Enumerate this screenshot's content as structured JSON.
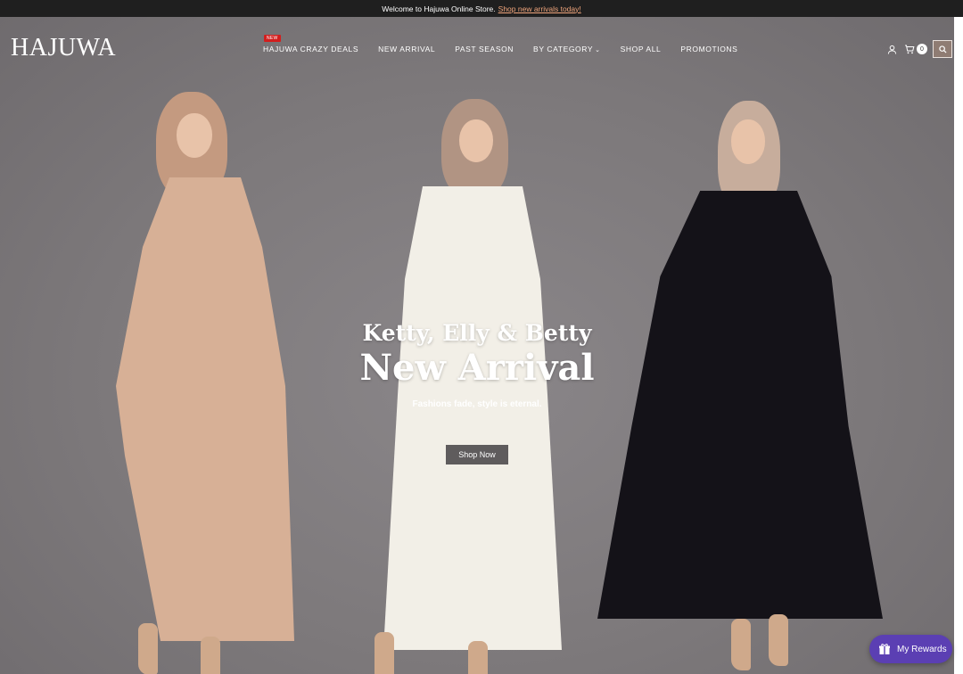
{
  "announcement": {
    "text": "Welcome to Hajuwa Online Store.",
    "link": "Shop new arrivals today!"
  },
  "header": {
    "logo": "HAJUWA",
    "nav": [
      {
        "label": "HAJUWA CRAZY DEALS",
        "badge": "NEW"
      },
      {
        "label": "NEW ARRIVAL"
      },
      {
        "label": "PAST SEASON"
      },
      {
        "label": "BY CATEGORY"
      },
      {
        "label": "SHOP ALL"
      },
      {
        "label": "PROMOTIONS"
      }
    ],
    "cart_count": "0",
    "icons": [
      "user-icon",
      "cart-icon",
      "search-icon"
    ]
  },
  "hero": {
    "subtitle": "Ketty, Elly & Betty",
    "title": "New Arrival",
    "tagline": "Fashions fade, style is eternal.",
    "cta": "Shop Now"
  },
  "rewards": {
    "label": "My Rewards"
  },
  "colors": {
    "announcement_bg": "#1f1f1f",
    "link_accent": "#f0a57c",
    "search_btn": "#8f7c73",
    "cta_bg": "#5f5c5d",
    "rewards_bg": "#5b3fb3"
  }
}
